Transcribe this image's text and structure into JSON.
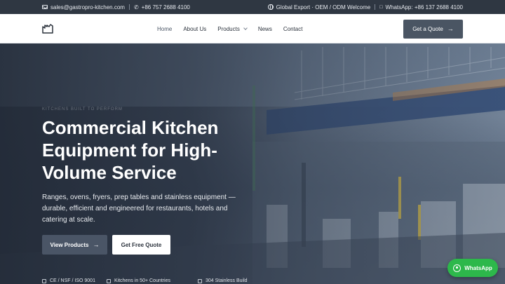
{
  "topbar": {
    "email": "sales@gastropro-kitchen.com",
    "phone": "+86 757 2688 4100",
    "tagline": "Global Export · OEM / ODM Welcome",
    "whatsapp": "WhatsApp: +86 137 2688 4100"
  },
  "nav": {
    "items": [
      {
        "label": "Home"
      },
      {
        "label": "About Us"
      },
      {
        "label": "Products"
      },
      {
        "label": "News"
      },
      {
        "label": "Contact"
      }
    ],
    "cta": "Get a Quote"
  },
  "hero": {
    "eyebrow": "KITCHENS BUILT TO PERFORM",
    "title_lines": [
      "Commercial Kitchen",
      "Equipment for High-",
      "Volume Service"
    ],
    "lead_lines": [
      "Ranges, ovens, fryers, prep tables and stainless equipment —",
      "durable, efficient and engineered for restaurants, hotels and",
      "catering at scale."
    ],
    "primary_button": "View Products",
    "secondary_button": "Get Free Quote",
    "badges": [
      "CE / NSF / ISO 9001",
      "Kitchens in 50+ Countries",
      "304 Stainless Build"
    ]
  },
  "whatsapp_float": "WhatsApp",
  "colors": {
    "accent": "#4a5563",
    "whatsapp": "#2db84b",
    "topbar": "#2f3742"
  }
}
